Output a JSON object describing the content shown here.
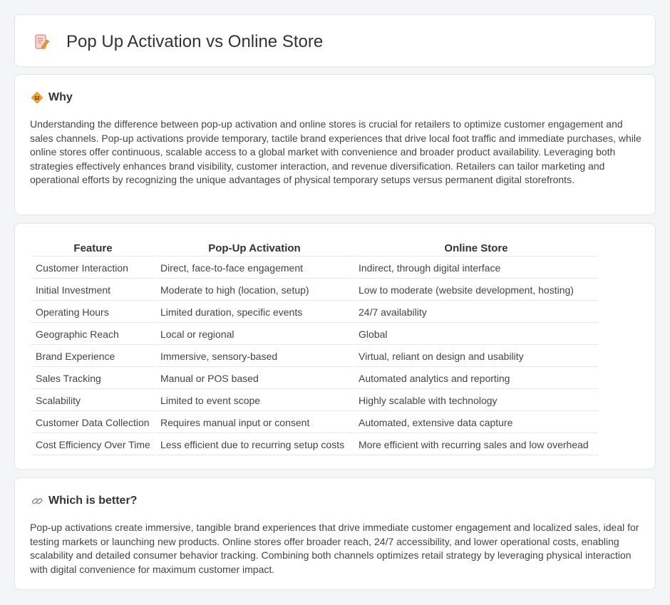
{
  "title": "Pop Up Activation vs Online Store",
  "icons": {
    "title": "document-edit-icon",
    "why": "diamond-sign-icon",
    "better": "link-icon"
  },
  "why": {
    "heading": "Why",
    "text": "Understanding the difference between pop-up activation and online stores is crucial for retailers to optimize customer engagement and sales channels. Pop-up activations provide temporary, tactile brand experiences that drive local foot traffic and immediate purchases, while online stores offer continuous, scalable access to a global market with convenience and broader product availability. Leveraging both strategies effectively enhances brand visibility, customer interaction, and revenue diversification. Retailers can tailor marketing and operational efforts by recognizing the unique advantages of physical temporary setups versus permanent digital storefronts."
  },
  "table": {
    "headers": [
      "Feature",
      "Pop-Up Activation",
      "Online Store"
    ],
    "rows": [
      [
        "Customer Interaction",
        "Direct, face-to-face engagement",
        "Indirect, through digital interface"
      ],
      [
        "Initial Investment",
        "Moderate to high (location, setup)",
        "Low to moderate (website development, hosting)"
      ],
      [
        "Operating Hours",
        "Limited duration, specific events",
        "24/7 availability"
      ],
      [
        "Geographic Reach",
        "Local or regional",
        "Global"
      ],
      [
        "Brand Experience",
        "Immersive, sensory-based",
        "Virtual, reliant on design and usability"
      ],
      [
        "Sales Tracking",
        "Manual or POS based",
        "Automated analytics and reporting"
      ],
      [
        "Scalability",
        "Limited to event scope",
        "Highly scalable with technology"
      ],
      [
        "Customer Data Collection",
        "Requires manual input or consent",
        "Automated, extensive data capture"
      ],
      [
        "Cost Efficiency Over Time",
        "Less efficient due to recurring setup costs",
        "More efficient with recurring sales and low overhead"
      ]
    ]
  },
  "better": {
    "heading": "Which is better?",
    "text": "Pop-up activations create immersive, tangible brand experiences that drive immediate customer engagement and localized sales, ideal for testing markets or launching new products. Online stores offer broader reach, 24/7 accessibility, and lower operational costs, enabling scalability and detailed consumer behavior tracking. Combining both channels optimizes retail strategy by leveraging physical interaction with digital convenience for maximum customer impact."
  }
}
